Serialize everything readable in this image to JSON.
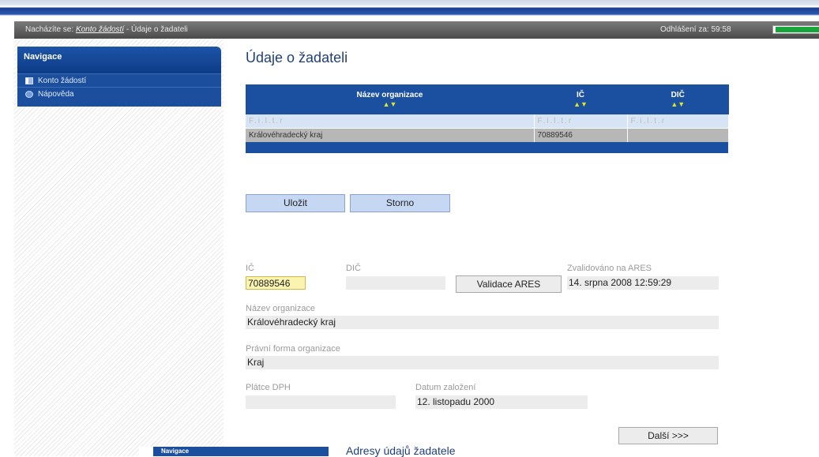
{
  "header": {
    "breadcrumb_prefix": "Nacházíte se:",
    "breadcrumb_link": "Konto žádostí",
    "breadcrumb_current": " - Údaje o žadateli",
    "logout_label": "Odhlášení za: 59:58",
    "timer_progress": 0.97
  },
  "nav": {
    "title": "Navigace",
    "items": [
      {
        "label": "Konto žádostí",
        "icon": "book-icon"
      },
      {
        "label": "Nápověda",
        "icon": "help-icon"
      }
    ]
  },
  "main": {
    "title": "Údaje o žadateli",
    "table": {
      "columns": [
        "Název organizace",
        "IČ",
        "DIČ"
      ],
      "sort_glyph": "▲▼",
      "filter_placeholder": "F.i.l.t.r",
      "rows": [
        [
          "Královéhradecký kraj",
          "70889546",
          ""
        ]
      ]
    },
    "buttons": {
      "save": "Uložit",
      "cancel": "Storno",
      "validate": "Validace ARES",
      "next": "Další >>>"
    },
    "form": {
      "ic_label": "IČ",
      "ic_value": "70889546",
      "dic_label": "DIČ",
      "dic_value": "",
      "ares_label": "Zvalidováno na ARES",
      "ares_value": "14. srpna 2008 12:59:29",
      "name_label": "Název organizace",
      "name_value": "Královéhradecký kraj",
      "legal_label": "Právní forma organizace",
      "legal_value": "Kraj",
      "vat_label": "Plátce DPH",
      "vat_value": "",
      "founded_label": "Datum založení",
      "founded_value": "12. listopadu 2000"
    }
  },
  "fragment": {
    "nav_title": "Navigace",
    "title": "Adresy údajů žadatele"
  },
  "colors": {
    "nav_blue": "#1b4f9e",
    "header_blue": "#1b4fa0",
    "title_blue": "#1f3f7a",
    "timer_green": "#17a63a",
    "highlight_field": "#fbf3b0"
  }
}
